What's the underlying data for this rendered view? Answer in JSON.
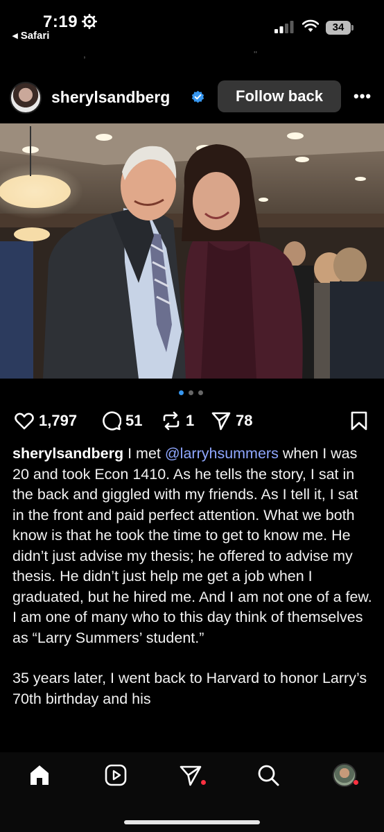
{
  "status_bar": {
    "time": "7:19",
    "back_app": "◂ Safari",
    "battery": "34"
  },
  "post": {
    "username": "sherylsandberg",
    "follow_label": "Follow back",
    "more_label": "•••",
    "photo_count": 3,
    "photo_active_index": 0,
    "likes": "1,797",
    "comments": "51",
    "reposts": "1",
    "shares": "78"
  },
  "caption": {
    "username": "sherylsandberg",
    "intro": " I met ",
    "mention": "@larryhsummers",
    "paragraph1": " when I was 20 and took Econ 1410. As he tells the story, I sat in the back and giggled with my friends. As I tell it, I sat in the front and paid perfect attention. What we both know is that he took the time to get to know me. He didn’t just advise my thesis; he offered to advise my thesis. He didn’t just help me get a job when I graduated, but he hired me. And I am not one of a few. I am one of many who to this day think of themselves as “Larry Summers’ student.”",
    "paragraph2": "35 years later, I went back to Harvard to honor Larry’s 70th birthday and his"
  },
  "colors": {
    "background": "#000000",
    "mention": "#8fa7ff",
    "verified": "#3797f0",
    "follow_button": "#363636",
    "notification_dot": "#ff3040"
  },
  "nav": {
    "items": [
      "home-icon",
      "reels-icon",
      "direct-messages-icon",
      "search-icon",
      "profile-avatar"
    ]
  }
}
